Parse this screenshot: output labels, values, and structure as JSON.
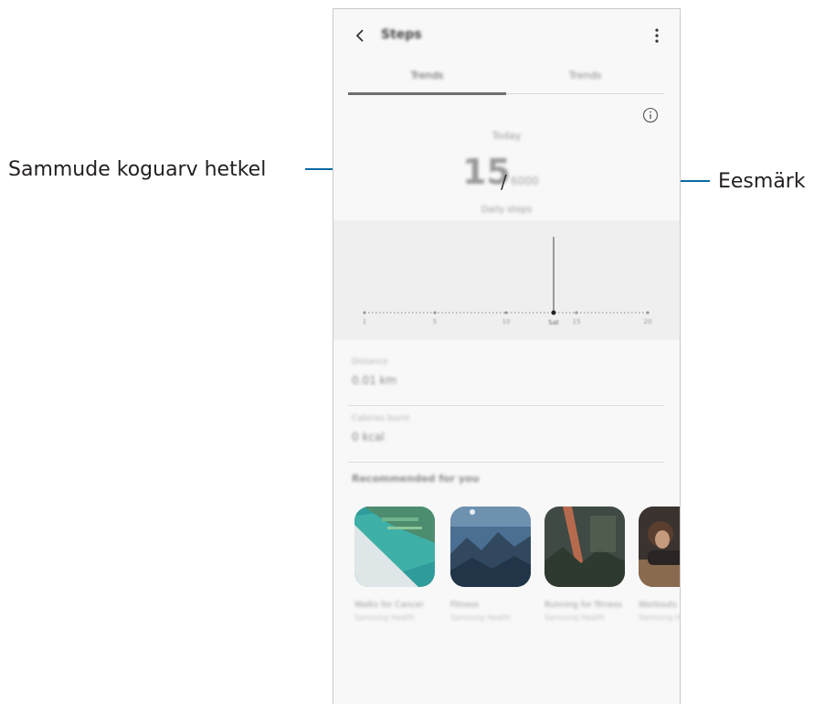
{
  "callouts": {
    "left": "Sammude koguarv hetkel",
    "right": "Eesmärk"
  },
  "app": {
    "title": "Steps",
    "tabs": [
      {
        "label": "Trends"
      },
      {
        "label": "Trends"
      }
    ]
  },
  "summary": {
    "label": "Today",
    "count": "15",
    "separator": "/",
    "goal": "6000",
    "unit": "Daily steps"
  },
  "chart": {
    "ticks": [
      "1",
      "5",
      "10",
      "15",
      "20"
    ],
    "current_label": "Sat"
  },
  "stats": [
    {
      "label": "Distance",
      "value": "0.01 km"
    },
    {
      "label": "Calories burnt",
      "value": "0 kcal"
    }
  ],
  "recommended": {
    "heading": "Recommended for you",
    "cards": [
      {
        "title": "Walks for Cancer",
        "sub": "Samsung Health"
      },
      {
        "title": "Fitness",
        "sub": "Samsung Health"
      },
      {
        "title": "Running for fitness",
        "sub": "Samsung Health"
      },
      {
        "title": "Workouts",
        "sub": "Samsung Health"
      }
    ]
  },
  "colors": {
    "leader": "#0b6aa2",
    "card_1": "#3aa3a0",
    "card_2": "#3c5d80",
    "card_3": "#3b4a3e",
    "card_4": "#5d4a3a"
  }
}
